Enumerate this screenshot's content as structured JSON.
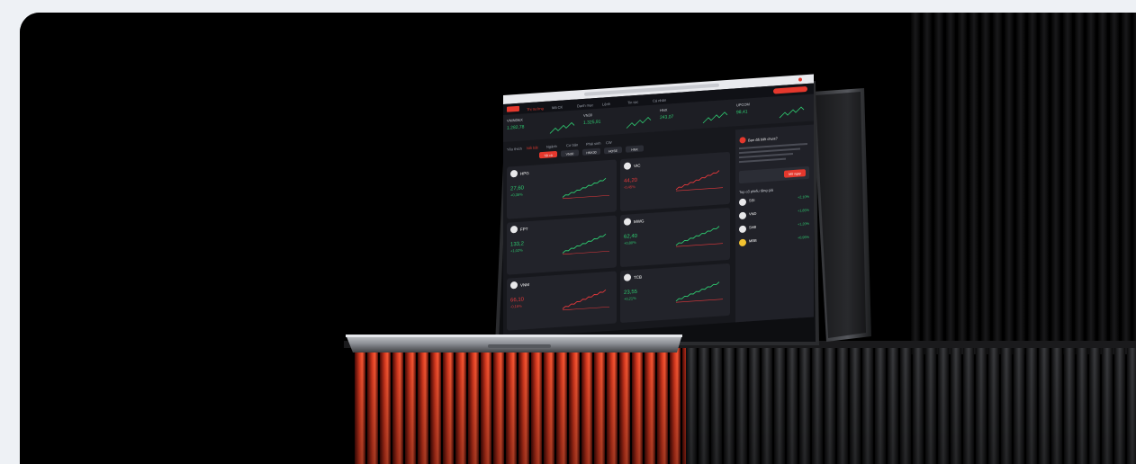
{
  "hero": {
    "colors": {
      "page_bg": "#eef1f5",
      "stage_bg": "#000000",
      "brand_red": "#e5382d",
      "up_green": "#2ecc71",
      "down_red": "#e5383b",
      "screen_bg": "#17181d"
    }
  },
  "laptop_screen": {
    "search_hint": "Nhập mã CK",
    "nav": [
      "Thị trường",
      "Mã CK",
      "Danh mục",
      "Lệnh",
      "Tin tức",
      "Cá nhân"
    ],
    "indices": [
      {
        "name": "VNINDEX",
        "value": "1.282,78"
      },
      {
        "name": "VN30",
        "value": "1.325,91"
      },
      {
        "name": "HNX",
        "value": "243,07"
      },
      {
        "name": "UPCOM",
        "value": "98,41"
      }
    ],
    "tabs": [
      "Yêu thích",
      "Nổi bật",
      "Ngành",
      "Cơ bản",
      "Phái sinh",
      "CW"
    ],
    "filter_chips": [
      "Tất cả",
      "VN30",
      "HNX30",
      "HOSE",
      "HNX"
    ],
    "cards": [
      {
        "code": "HPG",
        "price": "27,60",
        "change": "+0,35%"
      },
      {
        "code": "VIC",
        "price": "44,20",
        "change": "-0,45%"
      },
      {
        "code": "FPT",
        "price": "133,2",
        "change": "+1,02%"
      },
      {
        "code": "MWG",
        "price": "62,40",
        "change": "+0,80%"
      },
      {
        "code": "VNM",
        "price": "66,10",
        "change": "-0,15%"
      },
      {
        "code": "TCB",
        "price": "23,55",
        "change": "+0,21%"
      }
    ],
    "side_panel": {
      "title": "Bạn đã biết chưa?",
      "cta": "Mở ngay",
      "list_title": "Top cổ phiếu tăng giá",
      "list": [
        {
          "code": "SSI",
          "value": "+2,10%"
        },
        {
          "code": "VND",
          "value": "+1,85%"
        },
        {
          "code": "SHB",
          "value": "+1,20%"
        },
        {
          "code": "MBB",
          "value": "+0,95%"
        }
      ]
    }
  }
}
